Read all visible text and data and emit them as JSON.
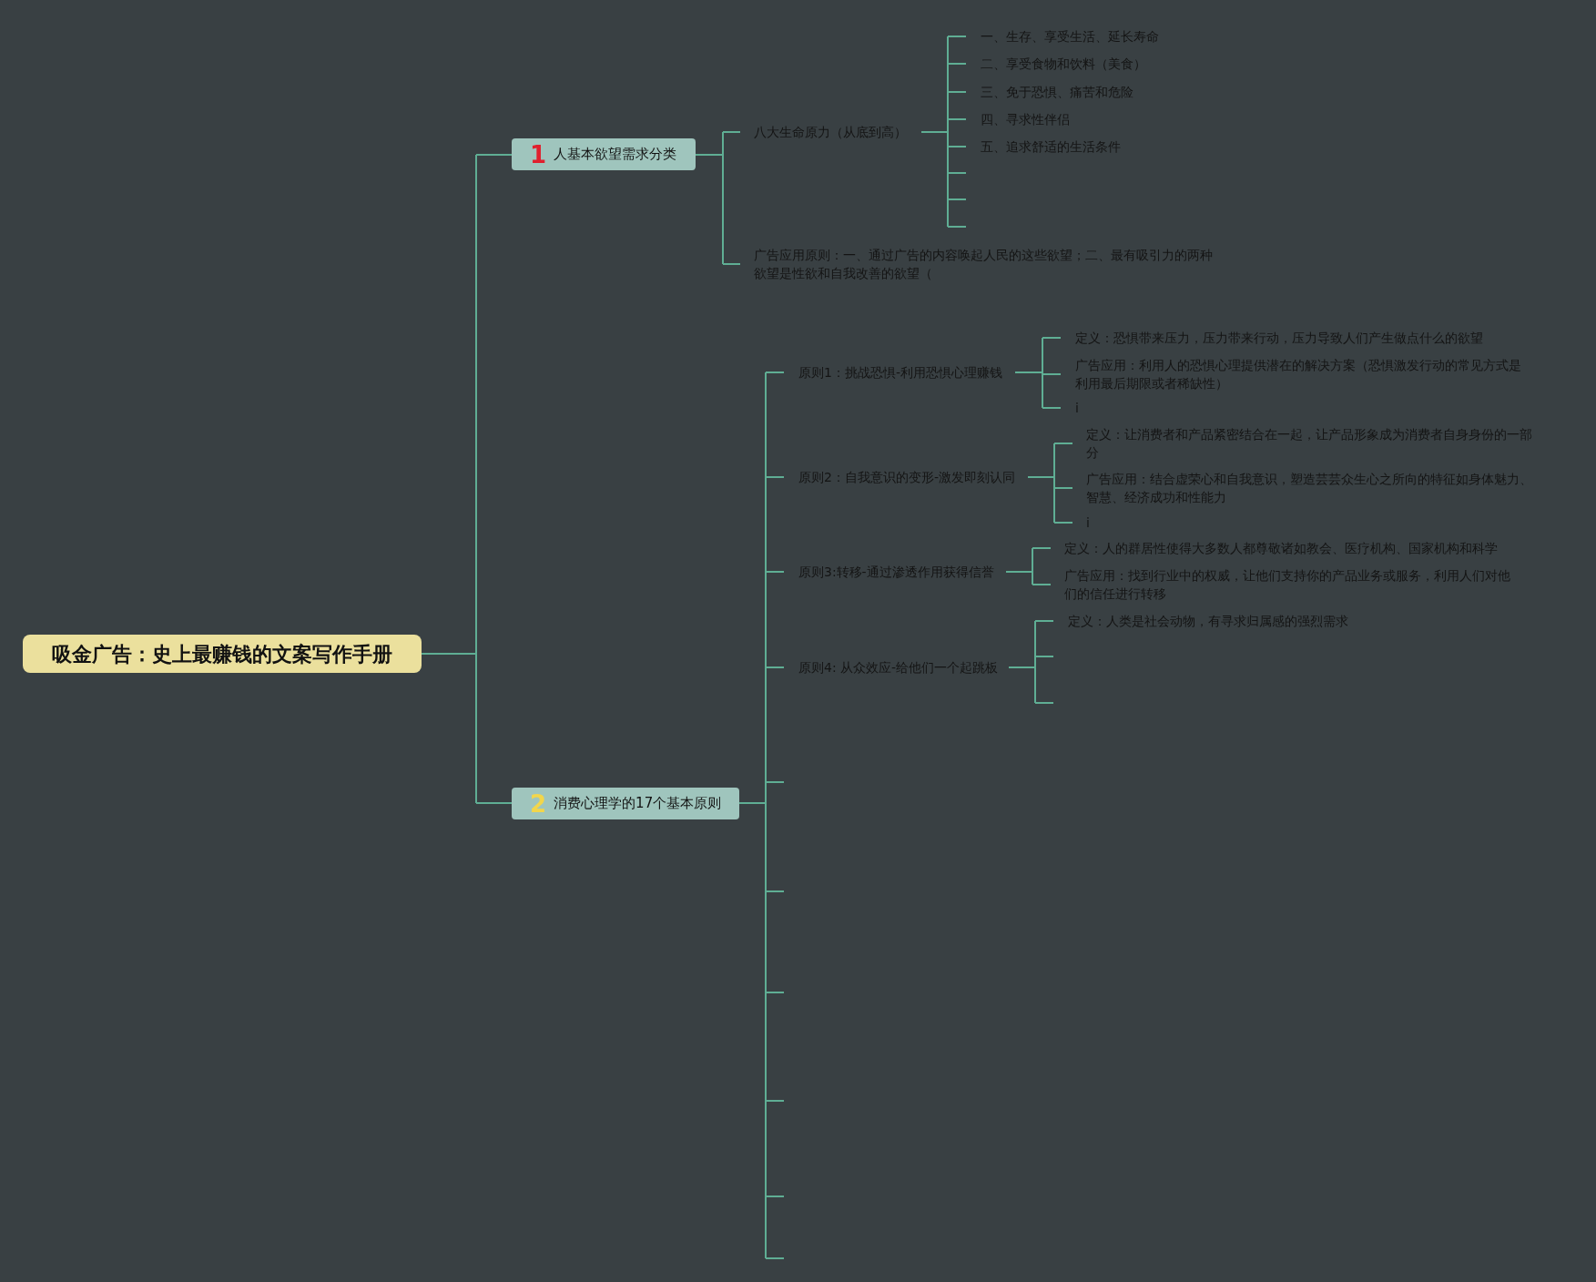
{
  "root": {
    "title": "吸金广告：史上最赚钱的文案写作手册"
  },
  "branches": [
    {
      "number": "1",
      "color": "#e0202e",
      "label": "人基本欲望需求分类",
      "children": [
        {
          "kind": "text",
          "text": "八大生命原力（从底到高）",
          "children": [
            {
              "kind": "text",
              "text": "一、生存、享受生活、延长寿命"
            },
            {
              "kind": "text",
              "text": "二、享受食物和饮料（美食）"
            },
            {
              "kind": "text",
              "text": "三、免于恐惧、痛苦和危险"
            },
            {
              "kind": "text",
              "text": "四、寻求性伴侣"
            },
            {
              "kind": "text",
              "text": "五、追求舒适的生活条件"
            },
            {
              "kind": "empty"
            },
            {
              "kind": "empty"
            },
            {
              "kind": "empty"
            }
          ]
        },
        {
          "kind": "text",
          "text": "广告应用原则：一、通过广告的内容唤起人民的这些欲望；二、最有吸引力的两种欲望是性欲和自我改善的欲望（"
        }
      ]
    },
    {
      "number": "2",
      "color": "#f2d64b",
      "label": "消费心理学的17个基本原则",
      "children": [
        {
          "kind": "text",
          "text": "原则1：挑战恐惧-利用恐惧心理赚钱",
          "children": [
            {
              "kind": "text",
              "text": "定义：恐惧带来压力，压力带来行动，压力导致人们产生做点什么的欲望"
            },
            {
              "kind": "text",
              "text": "广告应用：利用人的恐惧心理提供潜在的解决方案（恐惧激发行动的常见方式是利用最后期限或者稀缺性）"
            },
            {
              "kind": "text",
              "text": "i"
            }
          ]
        },
        {
          "kind": "text",
          "text": "原则2：自我意识的变形-激发即刻认同",
          "children": [
            {
              "kind": "text",
              "text": "定义：让消费者和产品紧密结合在一起，让产品形象成为消费者自身身份的一部分"
            },
            {
              "kind": "text",
              "text": "广告应用：结合虚荣心和自我意识，塑造芸芸众生心之所向的特征如身体魅力、智慧、经济成功和性能力"
            },
            {
              "kind": "text",
              "text": "i"
            }
          ]
        },
        {
          "kind": "text",
          "text": "原则3:转移-通过渗透作用获得信誉",
          "children": [
            {
              "kind": "text",
              "text": "定义：人的群居性使得大多数人都尊敬诸如教会、医疗机构、国家机构和科学"
            },
            {
              "kind": "text",
              "text": "广告应用：找到行业中的权威，让他们支持你的产品业务或服务，利用人们对他们的信任进行转移"
            }
          ]
        },
        {
          "kind": "text",
          "text": "原则4: 从众效应-给他们一个起跳板",
          "children": [
            {
              "kind": "text",
              "text": "定义：人类是社会动物，有寻求归属感的强烈需求"
            },
            {
              "kind": "empty"
            },
            {
              "kind": "empty"
            }
          ]
        },
        {
          "kind": "empty"
        },
        {
          "kind": "empty"
        },
        {
          "kind": "empty"
        },
        {
          "kind": "empty"
        },
        {
          "kind": "empty"
        },
        {
          "kind": "empty"
        }
      ]
    }
  ]
}
